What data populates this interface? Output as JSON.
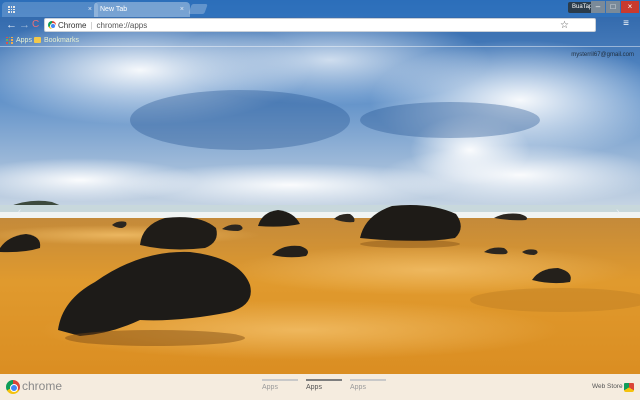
{
  "tabs": [
    {
      "label": "",
      "state": "inactive"
    },
    {
      "label": "New Tab",
      "state": "active"
    }
  ],
  "profile": {
    "label": "BuaTap"
  },
  "window_controls": {
    "minimize": "–",
    "maximize": "□",
    "close": "×"
  },
  "toolbar": {
    "back_icon": "←",
    "forward_icon": "→",
    "reload_icon": "C",
    "omnibox": {
      "chip_label": "Chrome",
      "separator": "|",
      "url": "chrome://apps"
    },
    "star_icon": "☆",
    "menu_icon": "≡"
  },
  "bookmarks": [
    {
      "label": "Apps",
      "icon": "apps-grid-icon"
    },
    {
      "label": "Bookmarks",
      "icon": "folder-icon"
    }
  ],
  "user": {
    "email": "mysterril67@gmail.com"
  },
  "page_arrows": {
    "left": "‹",
    "right": "›"
  },
  "bottom_bar": {
    "logo_text": "chrome",
    "pages": [
      {
        "label": "Apps",
        "selected": false
      },
      {
        "label": "Apps",
        "selected": true
      },
      {
        "label": "Apps",
        "selected": false
      }
    ],
    "webstore_label": "Web Store"
  },
  "colors": {
    "sky": "#3f78bf",
    "sand": "#d9922a",
    "close_button": "#c83a2e"
  }
}
